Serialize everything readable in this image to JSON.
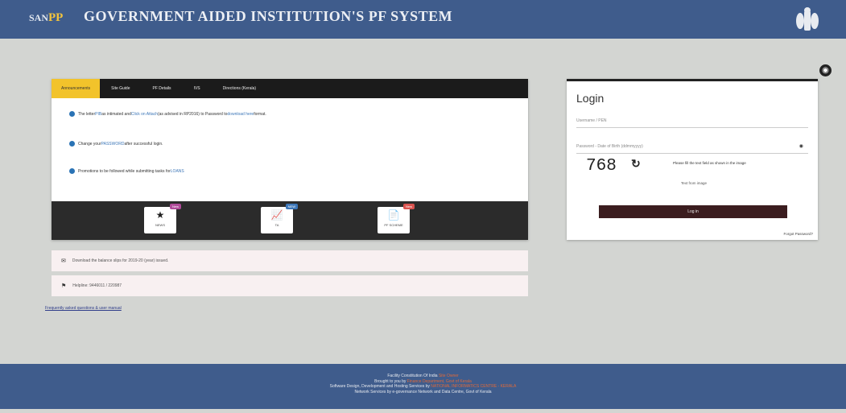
{
  "header": {
    "logo_prefix": "SAN",
    "logo_suffix": "PP",
    "title": "GOVERNMENT AIDED INSTITUTION'S PF SYSTEM"
  },
  "tabs": [
    {
      "label": "Announcements",
      "active": true
    },
    {
      "label": "Site Guide",
      "active": false
    },
    {
      "label": "PF Details",
      "active": false
    },
    {
      "label": "IVS",
      "active": false
    },
    {
      "label": "Directions (Kerala)",
      "active": false
    }
  ],
  "announcements": [
    {
      "pre": "The letter ",
      "link1": "PIB",
      "mid1": " as intimated and ",
      "link2": "Click on Attach",
      "mid2": " (as advised in RP2016) to Password to ",
      "link3": "download here",
      "post": " format."
    },
    {
      "pre": "Change your ",
      "link1": "PASSWORD",
      "mid1": " after successful login."
    },
    {
      "pre": "Promotions to be followed while submitting tasks for ",
      "link1": "LOANS"
    }
  ],
  "tiles": [
    {
      "label": "NEWS",
      "icon": "★",
      "badge": "New",
      "badge_color": "#b04a9a"
    },
    {
      "label": "TA",
      "icon": "📈",
      "badge": "NEW",
      "badge_color": "#3d77b8"
    },
    {
      "label": "PF SCHEME",
      "icon": "📄",
      "badge": "New",
      "badge_color": "#d9534f"
    }
  ],
  "notices": [
    {
      "icon": "✉",
      "text": "Download the balance slips for 2019-20 (year) issued."
    },
    {
      "icon": "⚑",
      "text": "Helpline: 9446011 / 220987"
    }
  ],
  "footlink": "Frequently asked questions & user manual",
  "login": {
    "title": "Login",
    "username_placeholder": "Username / PEN",
    "password_placeholder": "Password - Date of Birth (ddmmyyyy)",
    "captcha": "768",
    "captcha_hint": "Please fill the text field as shown in the image",
    "alt_image": "Text from image",
    "button": "Log in",
    "forgot": "Forgot Password?"
  },
  "footer": {
    "line1_pre": "Facility Constitution Of India ",
    "line1_link": "Site Owner",
    "line2_pre": "Brought to you by ",
    "line2_link": "Finance Department, Govt of Kerala",
    "line3_pre": "Software Design, Development and Hosting Services by ",
    "line3_link": "NATIONAL INFORMATICS CENTRE - KERALA",
    "line4": "Network Services by e-governance Network and Data Centre, Govt of Kerala"
  },
  "colors": {
    "header_bg": "#3f5c8c",
    "tab_active": "#f2c32b",
    "login_button": "#3b1d1f"
  }
}
